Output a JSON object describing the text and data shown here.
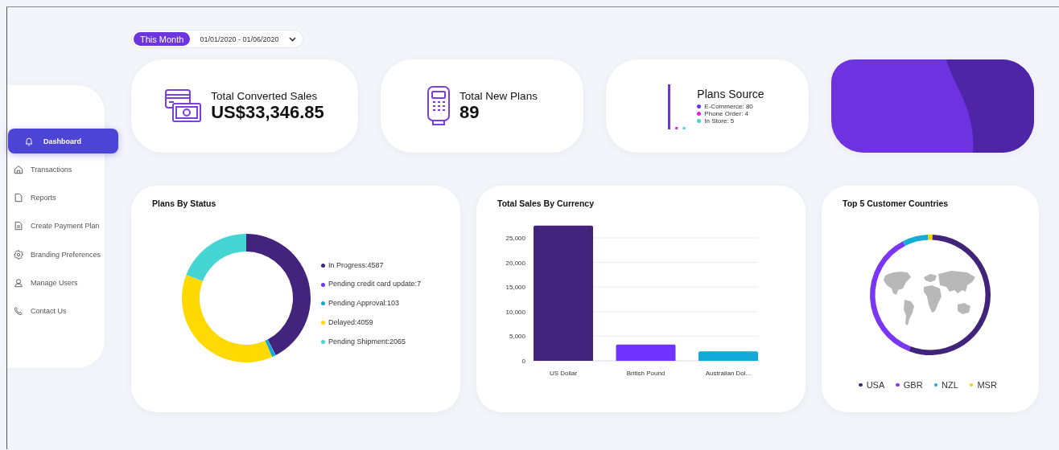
{
  "date_filter": {
    "preset": "This Month",
    "range": "01/01/2020 - 01/06/2020"
  },
  "sidebar": {
    "items": [
      {
        "label": "Dashboard",
        "selected": true
      },
      {
        "label": "Transactions",
        "selected": false
      },
      {
        "label": "Reports",
        "selected": false
      },
      {
        "label": "Create Payment Plan",
        "selected": false
      },
      {
        "label": "Branding Preferences",
        "selected": false
      },
      {
        "label": "Manage Users",
        "selected": false
      },
      {
        "label": "Contact Us",
        "selected": false
      }
    ]
  },
  "stats": [
    {
      "title": "Total Converted Sales",
      "value": "US$33,346.85"
    },
    {
      "title": "Total New Plans",
      "value": "89"
    }
  ],
  "plans_source": {
    "title": "Plans Source",
    "items": [
      {
        "label": "E-Commerce: 80",
        "color": "#6a35e0"
      },
      {
        "label": "Phone Order: 4",
        "color": "#e21ee0"
      },
      {
        "label": "In Store: 5",
        "color": "#45d4d4"
      }
    ]
  },
  "plans_by_status": {
    "title": "Plans By Status",
    "chart_data": {
      "type": "donut",
      "categories": [
        "In Progress:4587",
        "Pending credit card update:7",
        "Pending Approval:103",
        "Delayed:4059",
        "Pending Shipment:2065"
      ],
      "values": [
        4587,
        7,
        103,
        4059,
        2065
      ],
      "colors": [
        "#42247c",
        "#7034ff",
        "#12a9d8",
        "#ffd900",
        "#45d6d3"
      ]
    }
  },
  "sales_by_currency": {
    "title": "Total Sales By Currency",
    "chart_data": {
      "type": "bar",
      "categories": [
        "US Dollar",
        "British Pound",
        "Australian Dol..."
      ],
      "values": [
        27500,
        3300,
        1900
      ],
      "colors": [
        "#42247c",
        "#7034ff",
        "#12a9d8"
      ],
      "grid": true,
      "ylim": [
        0,
        27500
      ],
      "yticks": [
        {
          "value": 0,
          "label": "0"
        },
        {
          "value": 5000,
          "label": "5,000"
        },
        {
          "value": 10000,
          "label": "10,000"
        },
        {
          "value": 15000,
          "label": "15,000"
        },
        {
          "value": 20000,
          "label": "20,000"
        },
        {
          "value": 25000,
          "label": "25,000"
        }
      ]
    }
  },
  "customer_countries": {
    "title": "Top 5 Customer Countries",
    "legend": [
      {
        "label": "USA",
        "color": "#3f2479"
      },
      {
        "label": "GBR",
        "color": "#7b35f5"
      },
      {
        "label": "NZL",
        "color": "#12acd9"
      },
      {
        "label": "MSR",
        "color": "#f7d400"
      }
    ]
  }
}
